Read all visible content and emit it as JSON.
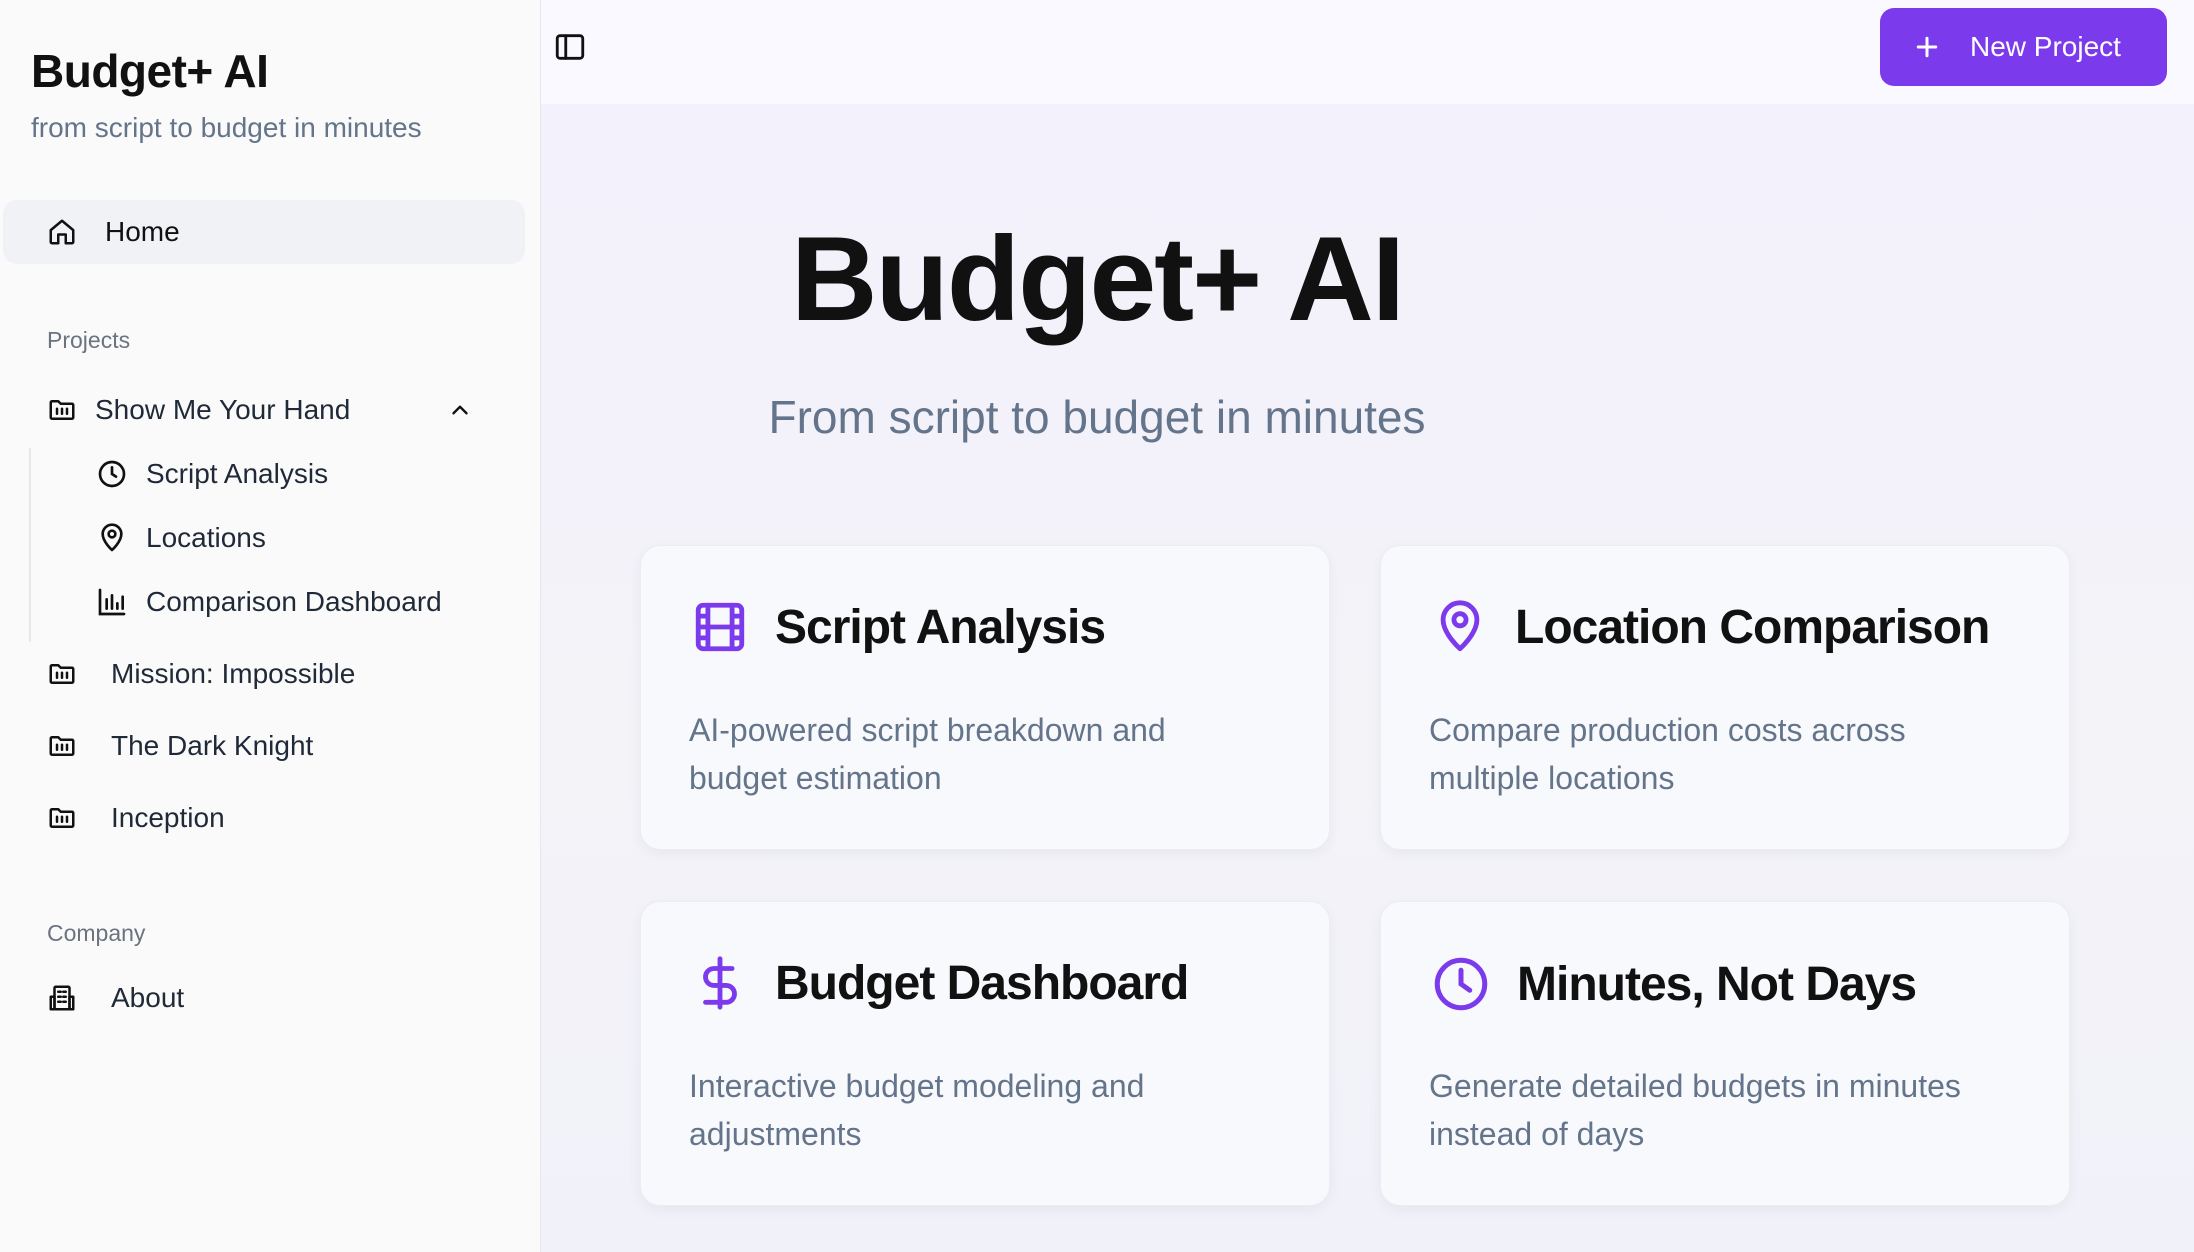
{
  "sidebar": {
    "brand_title": "Budget+ AI",
    "brand_subtitle": "from script to budget in minutes",
    "home_label": "Home",
    "projects_section": "Projects",
    "active_project": "Show Me Your Hand",
    "sub_items": [
      "Script Analysis",
      "Locations",
      "Comparison Dashboard"
    ],
    "other_projects": [
      "Mission: Impossible",
      "The Dark Knight",
      "Inception"
    ],
    "company_section": "Company",
    "about_label": "About"
  },
  "toolbar": {
    "new_project_label": "New Project"
  },
  "hero": {
    "title": "Budget+ AI",
    "subtitle": "From script to budget in minutes"
  },
  "cards": [
    {
      "title": "Script Analysis",
      "description": "AI-powered script breakdown and budget estimation",
      "icon": "film-icon"
    },
    {
      "title": "Location Comparison",
      "description": "Compare production costs across multiple locations",
      "icon": "map-pin-icon"
    },
    {
      "title": "Budget Dashboard",
      "description": "Interactive budget modeling and adjustments",
      "icon": "dollar-icon"
    },
    {
      "title": "Minutes, Not Days",
      "description": "Generate detailed budgets in minutes instead of days",
      "icon": "clock-icon"
    }
  ],
  "colors": {
    "accent": "#7c3aed",
    "muted_text": "#64748b",
    "sidebar_bg": "#fafafa"
  }
}
